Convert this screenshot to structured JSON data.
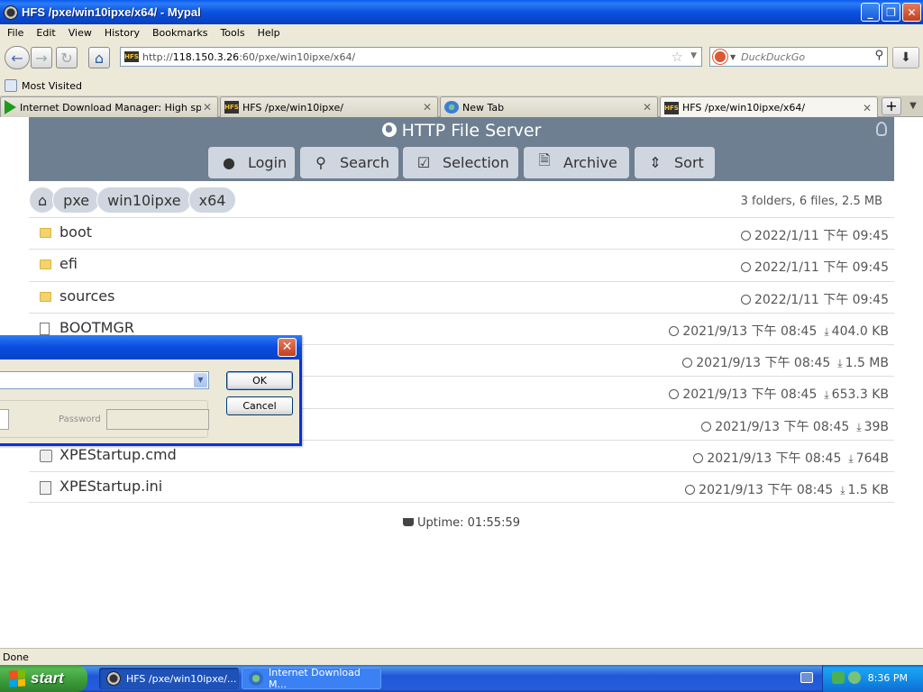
{
  "window": {
    "title": "HFS /pxe/win10ipxe/x64/ - Mypal",
    "minimize": "_",
    "maximize": "❐",
    "close": "✕"
  },
  "menu": [
    "File",
    "Edit",
    "View",
    "History",
    "Bookmarks",
    "Tools",
    "Help"
  ],
  "nav": {
    "url_host": "http://118.150.3.26",
    "url_host_strong": "118.150.3.26",
    "url_rest": ":60/pxe/win10ipxe/x64/",
    "url_prefix": "http://",
    "search_placeholder": "DuckDuckGo"
  },
  "bookmarks": {
    "most_visited": "Most Visited"
  },
  "tabs": [
    {
      "label": "Internet Download Manager: High spee...",
      "icon": "idm-icon"
    },
    {
      "label": "HFS /pxe/win10ipxe/",
      "icon": "hfs-icon"
    },
    {
      "label": "New Tab",
      "icon": "newtab-icon"
    },
    {
      "label": "HFS /pxe/win10ipxe/x64/",
      "icon": "hfs-icon",
      "active": true
    }
  ],
  "hfs": {
    "title": "HTTP File Server",
    "buttons": [
      "Login",
      "Search",
      "Selection",
      "Archive",
      "Sort"
    ],
    "breadcrumb": [
      "pxe",
      "win10ipxe",
      "x64"
    ],
    "summary": "3 folders, 6 files, 2.5 MB",
    "rows": [
      {
        "name": "boot",
        "type": "folder",
        "date": "2022/1/11 下午 09:45",
        "size": ""
      },
      {
        "name": "efi",
        "type": "folder",
        "date": "2022/1/11 下午 09:45",
        "size": ""
      },
      {
        "name": "sources",
        "type": "folder",
        "date": "2022/1/11 下午 09:45",
        "size": ""
      },
      {
        "name": "BOOTMGR",
        "type": "file",
        "date": "2021/9/13 下午 08:45",
        "size": "404.0 KB"
      },
      {
        "name": "",
        "type": "file",
        "date": "2021/9/13 下午 08:45",
        "size": "1.5 MB"
      },
      {
        "name": "",
        "type": "file",
        "date": "2021/9/13 下午 08:45",
        "size": "653.3 KB"
      },
      {
        "name": "",
        "type": "file",
        "date": "2021/9/13 下午 08:45",
        "size": "39B"
      },
      {
        "name": "XPEStartup.cmd",
        "type": "cmd",
        "date": "2021/9/13 下午 08:45",
        "size": "764B"
      },
      {
        "name": "XPEStartup.ini",
        "type": "ini",
        "date": "2021/9/13 下午 08:45",
        "size": "1.5 KB"
      }
    ],
    "uptime": "Uptime: 01:55:59"
  },
  "dialog": {
    "ok": "OK",
    "cancel": "Cancel",
    "password_label": "Password"
  },
  "status": {
    "text": "Done"
  },
  "taskbar": {
    "start": "start",
    "items": [
      "HFS /pxe/win10ipxe/...",
      "Internet Download M..."
    ],
    "clock": "8:36 PM"
  }
}
